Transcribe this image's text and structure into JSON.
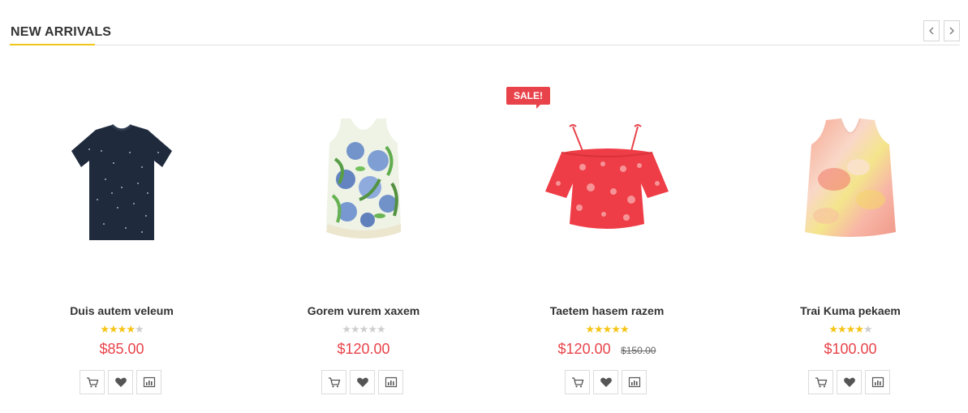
{
  "section": {
    "title": "NEW ARRIVALS",
    "accent_color": "#f0c419",
    "prev_icon": "chevron-left-icon",
    "next_icon": "chevron-right-icon"
  },
  "products": [
    {
      "name": "Duis autem veleum",
      "rating": 4,
      "rating_max": 5,
      "price": "$85.00",
      "old_price": "",
      "sale_badge": ""
    },
    {
      "name": "Gorem vurem xaxem",
      "rating": 0,
      "rating_max": 5,
      "price": "$120.00",
      "old_price": "",
      "sale_badge": ""
    },
    {
      "name": "Taetem hasem razem",
      "rating": 5,
      "rating_max": 5,
      "price": "$120.00",
      "old_price": "$150.00",
      "sale_badge": "SALE!"
    },
    {
      "name": "Trai Kuma pekaem",
      "rating": 4,
      "rating_max": 5,
      "price": "$100.00",
      "old_price": "",
      "sale_badge": ""
    }
  ],
  "actions": [
    "add-to-cart-icon",
    "heart-icon",
    "compare-icon"
  ],
  "colors": {
    "price": "#e8434a",
    "star_on": "#f5c518",
    "star_off": "#cfcfcf",
    "sale_badge": "#e8434a"
  }
}
